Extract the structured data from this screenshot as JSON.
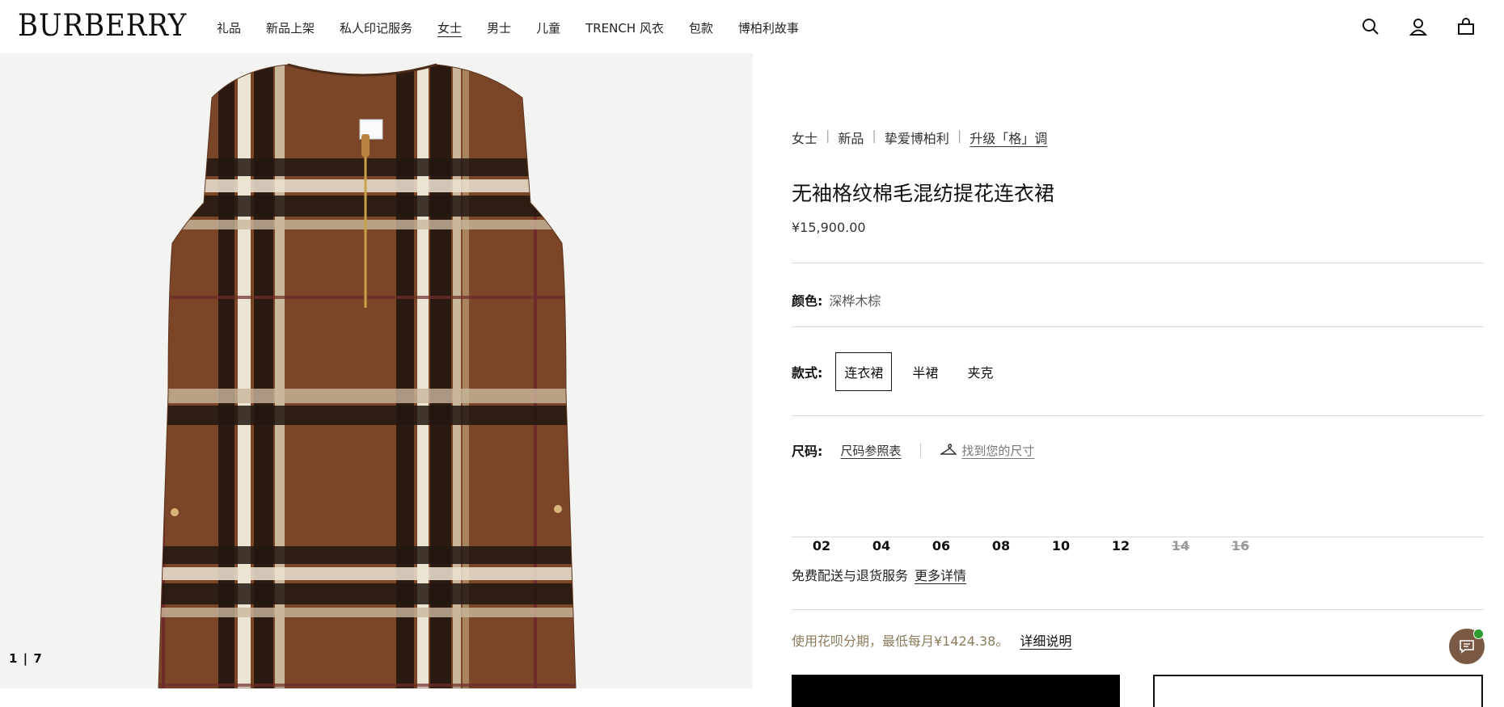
{
  "header": {
    "logo": "BURBERRY",
    "nav": [
      "礼品",
      "新品上架",
      "私人印记服务",
      "女士",
      "男士",
      "儿童",
      "TRENCH 风衣",
      "包款",
      "博柏利故事"
    ],
    "active_nav": "女士",
    "icons": [
      "search-icon",
      "account-icon",
      "bag-icon"
    ]
  },
  "gallery": {
    "counter": "1 | 7"
  },
  "product": {
    "breadcrumb": [
      "女士",
      "新品",
      "挚爱博柏利",
      "升级「格」调"
    ],
    "title": "无袖格纹棉毛混纺提花连衣裙",
    "price": "¥15,900.00",
    "color_label": "颜色:",
    "color_value": "深桦木棕",
    "style_label": "款式:",
    "styles": [
      "连衣裙",
      "半裙",
      "夹克"
    ],
    "selected_style": "连衣裙",
    "size_label": "尺码:",
    "size_chart": "尺码参照表",
    "find_size": "找到您的尺寸",
    "sizes": [
      {
        "label": "02",
        "available": true
      },
      {
        "label": "04",
        "available": true
      },
      {
        "label": "06",
        "available": true
      },
      {
        "label": "08",
        "available": true
      },
      {
        "label": "10",
        "available": true
      },
      {
        "label": "12",
        "available": true
      },
      {
        "label": "14",
        "available": false
      },
      {
        "label": "16",
        "available": false
      }
    ],
    "delivery_text": "免费配送与退货服务",
    "delivery_link": "更多详情",
    "installment_text": "使用花呗分期，最低每月¥1424.38。",
    "installment_link": "详细说明"
  },
  "colors": {
    "accent_brown": "#7a5a45",
    "installment_text": "#8c7b5e",
    "online_dot": "#2d9b2d"
  }
}
